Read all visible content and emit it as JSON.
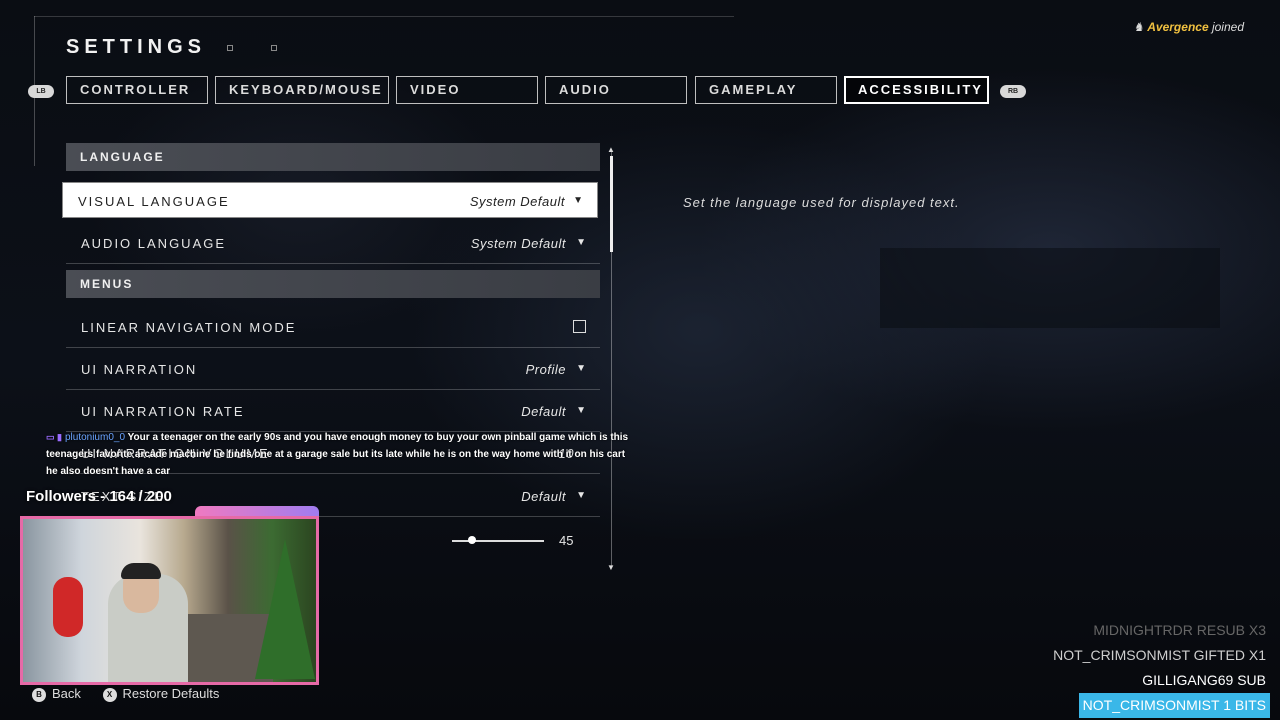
{
  "header": {
    "title": "SETTINGS"
  },
  "notification": {
    "name": "Avergence",
    "text": "joined"
  },
  "shoulder_buttons": {
    "left": "LB",
    "right": "RB"
  },
  "tabs": [
    {
      "label": "CONTROLLER",
      "active": false
    },
    {
      "label": "KEYBOARD/MOUSE",
      "active": false
    },
    {
      "label": "VIDEO",
      "active": false
    },
    {
      "label": "AUDIO",
      "active": false
    },
    {
      "label": "GAMEPLAY",
      "active": false
    },
    {
      "label": "ACCESSIBILITY",
      "active": true
    }
  ],
  "sections": {
    "language": "LANGUAGE",
    "menus": "MENUS"
  },
  "rows": {
    "visual_language": {
      "label": "VISUAL LANGUAGE",
      "value": "System Default"
    },
    "audio_language": {
      "label": "AUDIO LANGUAGE",
      "value": "System Default"
    },
    "linear_nav": {
      "label": "LINEAR NAVIGATION MODE",
      "checked": false
    },
    "ui_narration": {
      "label": "UI NARRATION",
      "value": "Profile"
    },
    "ui_narration_rate": {
      "label": "UI NARRATION RATE",
      "value": "Default"
    },
    "ui_narration_volume": {
      "label": "UI NARRATION VOLUME",
      "value": "10"
    },
    "text_size": {
      "label": "TEXT SIZE",
      "value": "Default"
    },
    "slider_row": {
      "value": "45"
    }
  },
  "description": "Set the language used for displayed text.",
  "chat": {
    "user": "plutonium0_0",
    "message": "Your a teenager on the early 90s and you have enough money to buy your own pinball game which is this teenagers favorite arcade machine he finds one at a garage sale but its late while he is on the way home with it on his cart he also doesn't have a car"
  },
  "followers": "Followers - 164 / 200",
  "footer": {
    "back": "Back",
    "back_btn": "B",
    "restore": "Restore Defaults",
    "restore_btn": "X"
  },
  "events": [
    {
      "text": "MIDNIGHTRDR  RESUB X3"
    },
    {
      "text": "NOT_CRIMSONMIST  GIFTED X1"
    },
    {
      "text": "GILLIGANG69  SUB"
    },
    {
      "text": "NOT_CRIMSONMIST  1 BITS"
    }
  ],
  "colors": {
    "accent_pink": "#e66aa7",
    "event_highlight": "#3ab7e8",
    "notify_name": "#f0c040"
  }
}
